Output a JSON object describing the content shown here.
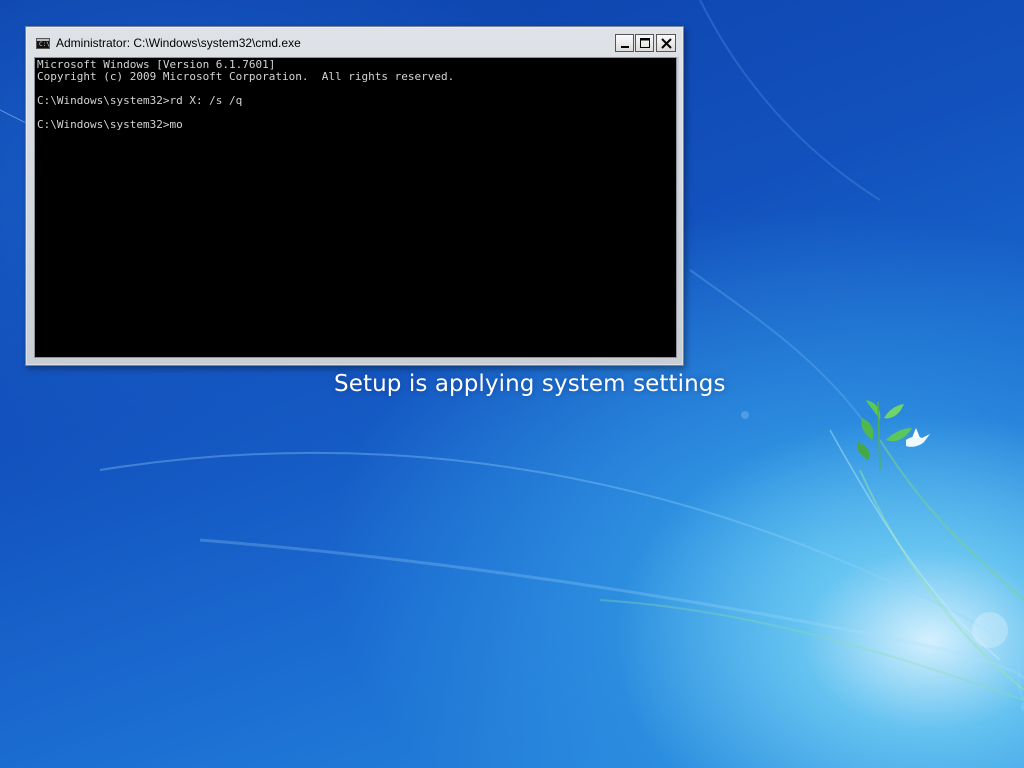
{
  "window": {
    "title": "Administrator: C:\\Windows\\system32\\cmd.exe",
    "icon_label": "C:\\",
    "controls": {
      "minimize": "minimize-icon",
      "maximize": "maximize-icon",
      "close": "close-icon"
    }
  },
  "console": {
    "lines": [
      "Microsoft Windows [Version 6.1.7601]",
      "Copyright (c) 2009 Microsoft Corporation.  All rights reserved.",
      "",
      "C:\\Windows\\system32>rd X: /s /q",
      "",
      "C:\\Windows\\system32>mo"
    ]
  },
  "setup": {
    "status_text": "Setup is applying system settings"
  },
  "colors": {
    "console_bg": "#000000",
    "console_fg": "#d4d4d4",
    "desktop_blue": "#1251bd"
  }
}
